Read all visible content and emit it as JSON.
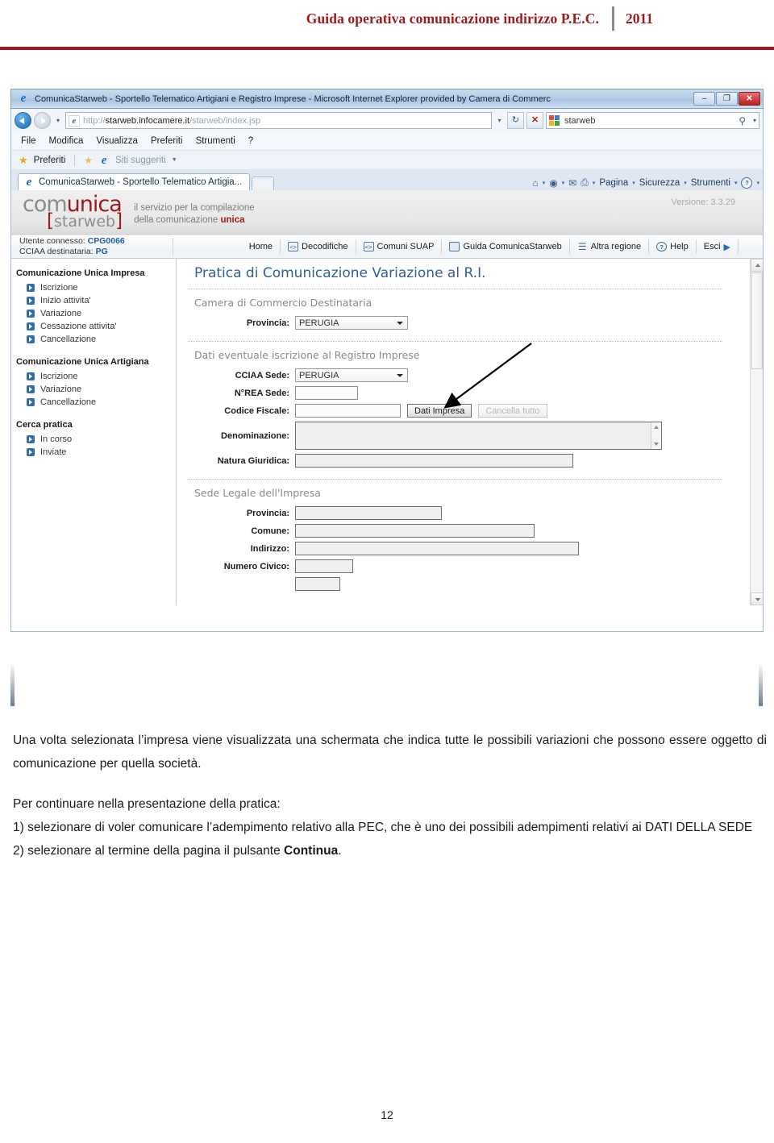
{
  "document": {
    "header_title": "Guida operativa comunicazione indirizzo P.E.C.",
    "header_year": "2011",
    "page_number": "12",
    "accent_color": "#9E1B1B",
    "paragraph1": "Una volta selezionata l’impresa viene visualizzata una schermata che indica tutte le possibili variazioni che possono essere oggetto di comunicazione per quella società.",
    "paragraph2_line1": "Per continuare nella presentazione della pratica:",
    "paragraph2_line2": "1) selezionare di voler comunicare l’adempimento relativo alla PEC, che è uno dei possibili adempimenti relativi ai DATI DELLA SEDE",
    "paragraph2_line3_pre": "2) selezionare al termine della pagina il pulsante ",
    "paragraph2_line3_bold": "Continua",
    "paragraph2_line3_post": "."
  },
  "browser": {
    "window_title": "ComunicaStarweb - Sportello Telematico Artigiani e Registro Imprese - Microsoft Internet Explorer provided by Camera di Commerc",
    "minimize_glyph": "–",
    "maximize_glyph": "❐",
    "close_glyph": "✕",
    "address_protocol": "http://",
    "address_host": "starweb.infocamere.it",
    "address_path": "/starweb/index.jsp",
    "address_dropdown_glyph": "▾",
    "refresh_glyph": "↻",
    "stop_glyph": "✕",
    "search_value": "starweb",
    "search_magnifier": "⚲",
    "search_dropdown_glyph": "▾",
    "menu": [
      "File",
      "Modifica",
      "Visualizza",
      "Preferiti",
      "Strumenti",
      "?"
    ],
    "favorites_label": "Preferiti",
    "suggested_sites_label": "Siti suggeriti",
    "tab_title": "ComunicaStarweb - Sportello Telematico Artigia...",
    "command_bar": {
      "home_icon": "⌂",
      "feeds_icon": "◉",
      "mail_icon": "✉",
      "print_icon": "⎙",
      "page_label": "Pagina",
      "security_label": "Sicurezza",
      "tools_label": "Strumenti",
      "help_icon": "?",
      "caret": "▾"
    }
  },
  "app": {
    "logo_part1_a": "com",
    "logo_part1_b": "unica",
    "logo_bracket_open": "[",
    "logo_part2": "starweb",
    "logo_bracket_close": "]",
    "tagline_line1": "il servizio per la compilazione",
    "tagline_line2_pre": "della comunicazione ",
    "tagline_line2_em": "unica",
    "version": "Versione: 3.3.29",
    "user_label": "Utente connesso:",
    "user_value": "CPG0066",
    "cciaa_label": "CCIAA destinataria:",
    "cciaa_value": "PG",
    "nav": [
      {
        "label": "Home",
        "icon": ""
      },
      {
        "label": "Decodifiche",
        "icon": "code-icon"
      },
      {
        "label": "Comuni SUAP",
        "icon": "code-icon"
      },
      {
        "label": "Guida ComunicaStarweb",
        "icon": "document-icon"
      },
      {
        "label": "Altra regione",
        "icon": "globe-icon"
      },
      {
        "label": "Help",
        "icon": "help-icon"
      },
      {
        "label": "Esci",
        "icon": "exit-arrow-icon"
      }
    ]
  },
  "sidebar": {
    "groups": [
      {
        "title": "Comunicazione Unica Impresa",
        "items": [
          "Iscrizione",
          "Inizio attivita'",
          "Variazione",
          "Cessazione attivita'",
          "Cancellazione"
        ]
      },
      {
        "title": "Comunicazione Unica Artigiana",
        "items": [
          "Iscrizione",
          "Variazione",
          "Cancellazione"
        ]
      },
      {
        "title": "Cerca pratica",
        "items": [
          "In corso",
          "Inviate"
        ]
      }
    ]
  },
  "form": {
    "title": "Pratica di Comunicazione Variazione al R.I.",
    "section1_head": "Camera di Commercio Destinataria",
    "section1_provincia_label": "Provincia:",
    "section1_provincia_value": "PERUGIA",
    "section2_head": "Dati eventuale iscrizione al Registro Imprese",
    "cciaa_sede_label": "CCIAA Sede:",
    "cciaa_sede_value": "PERUGIA",
    "nrea_label": "N°REA Sede:",
    "nrea_value": "",
    "codice_fiscale_label": "Codice Fiscale:",
    "codice_fiscale_value": "",
    "btn_dati_impresa": "Dati Impresa",
    "btn_cancella_tutto": "Cancella tutto",
    "denominazione_label": "Denominazione:",
    "denominazione_value": "",
    "natura_label": "Natura Giuridica:",
    "natura_value": "",
    "section3_head": "Sede Legale dell'Impresa",
    "sede_provincia_label": "Provincia:",
    "sede_provincia_value": "",
    "sede_comune_label": "Comune:",
    "sede_comune_value": "",
    "sede_indirizzo_label": "Indirizzo:",
    "sede_indirizzo_value": "",
    "sede_civico_label": "Numero Civico:",
    "sede_civico_value": ""
  }
}
